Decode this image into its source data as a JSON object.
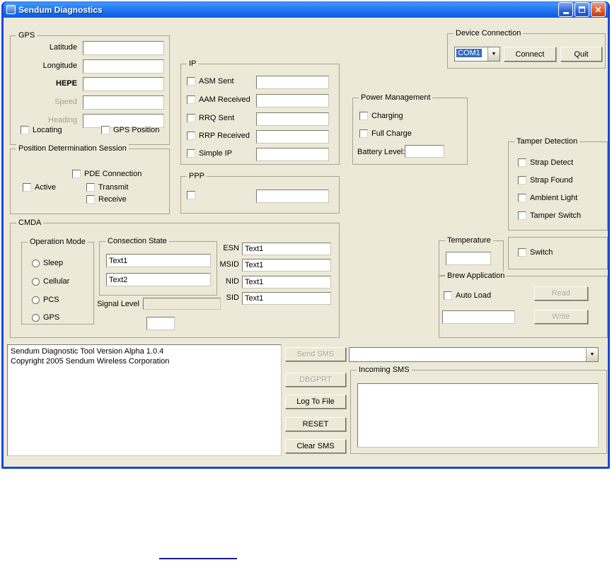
{
  "window": {
    "title": "Sendum Diagnostics"
  },
  "colors": {
    "titlebar_blue": "#2a7ff2",
    "selection_blue": "#316ac5",
    "client_bg": "#ece9d8",
    "close_red": "#e35e31"
  },
  "device_connection": {
    "title": "Device Connection",
    "port_value": "COM1",
    "connect_label": "Connect",
    "quit_label": "Quit"
  },
  "gps": {
    "title": "GPS",
    "fields": [
      {
        "label": "Latitude",
        "value": "",
        "disabled": false
      },
      {
        "label": "Longitude",
        "value": "",
        "disabled": false
      },
      {
        "label": "HEPE",
        "value": "",
        "disabled": false
      },
      {
        "label": "Speed",
        "value": "",
        "disabled": true
      },
      {
        "label": "Heading",
        "value": "",
        "disabled": true
      }
    ],
    "locating_label": "Locating",
    "gps_position_label": "GPS Position"
  },
  "position_session": {
    "title": "Position Determination Session",
    "pde_connection_label": "PDE Connection",
    "active_label": "Active",
    "transmit_label": "Transmit",
    "receive_label": "Receive"
  },
  "ip": {
    "title": "IP",
    "rows": [
      {
        "label": "ASM Sent",
        "value": ""
      },
      {
        "label": "AAM Received",
        "value": ""
      },
      {
        "label": "RRQ Sent",
        "value": ""
      },
      {
        "label": "RRP Received",
        "value": ""
      },
      {
        "label": "Simple IP",
        "value": ""
      }
    ]
  },
  "ppp": {
    "title": "PPP",
    "value": ""
  },
  "power": {
    "title": "Power Management",
    "charging_label": "Charging",
    "full_charge_label": "Full Charge",
    "battery_level_label": "Battery Level:",
    "battery_value": ""
  },
  "tamper": {
    "title": "Tamper Detection",
    "items": [
      "Strap Detect",
      "Strap Found",
      "Ambient Light",
      "Tamper Switch"
    ]
  },
  "cmda": {
    "title": "CMDA",
    "operation_mode": {
      "title": "Operation Mode",
      "options": [
        "Sleep",
        "Cellular",
        "PCS",
        "GPS"
      ]
    },
    "connection_state": {
      "title": "Consection State",
      "line1": "Text1",
      "line2": "Text2"
    },
    "registers": [
      {
        "label": "ESN",
        "value": "Text1"
      },
      {
        "label": "MSID",
        "value": "Text1"
      },
      {
        "label": "NID",
        "value": "Text1"
      },
      {
        "label": "SID",
        "value": "Text1"
      }
    ],
    "signal_level_label": "Signal Level",
    "signal_level_value": ""
  },
  "temperature": {
    "title": "Temperature",
    "value": ""
  },
  "switch_group": {
    "switch_label": "Switch"
  },
  "brew": {
    "title": "Brew Application",
    "auto_load_label": "Auto Load",
    "read_label": "Read",
    "write_label": "Write",
    "value": ""
  },
  "log": {
    "line1": "Sendum Diagnostic Tool Version Alpha 1.0.4",
    "line2": "Copyright 2005 Sendum Wireless Corporation"
  },
  "actions": {
    "send_sms": "Send SMS",
    "dbgprt": "DBGPRT",
    "log_to_file": "Log To File",
    "reset": "RESET",
    "clear_sms": "Clear SMS"
  },
  "sms_combo": {
    "value": ""
  },
  "incoming_sms": {
    "title": "Incoming SMS",
    "value": ""
  }
}
